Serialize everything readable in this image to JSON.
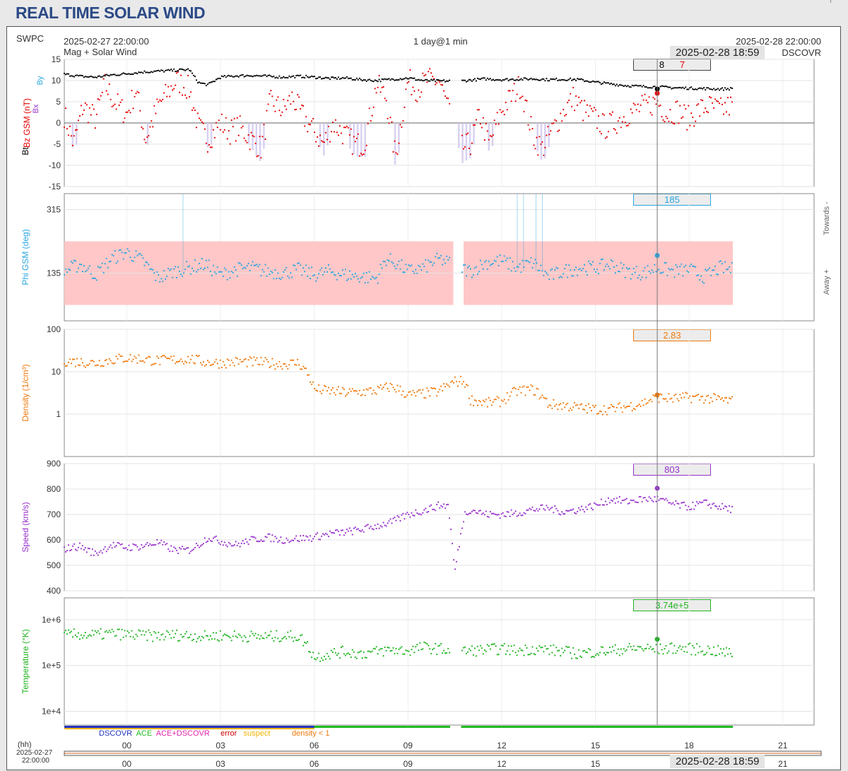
{
  "page": {
    "title": "REAL TIME SOLAR WIND"
  },
  "header": {
    "source": "SWPC",
    "start_time": "2025-02-27 22:00:00",
    "plot_kind": "Mag + Solar Wind",
    "span": "1 day@1 min",
    "end_time": "2025-02-28 22:00:00",
    "cursor_time": "2025-02-28 18:59",
    "spacecraft": "DSCOVR"
  },
  "colors": {
    "bt": "#000000",
    "bz": "#e60000",
    "phi": "#2aa6e0",
    "density": "#f07a0f",
    "speed": "#9933cc",
    "temperature": "#22b522",
    "bz_shade": "#cfc6ec",
    "phi_shade": "#ffc7c7"
  },
  "chart_data": [
    {
      "type": "scatter",
      "name": "mag",
      "ylabel_parts": [
        "Bt",
        "Bz GSM (nT)",
        "Bx",
        "By"
      ],
      "ylim": [
        -15,
        15
      ],
      "yticks": [
        15,
        10,
        5,
        0,
        -5,
        -10,
        -15
      ],
      "readout": {
        "bt": "8",
        "bz": "7"
      },
      "series": [
        {
          "name": "Bt",
          "x": [
            0,
            0.5,
            1,
            1.5,
            2,
            2.5,
            3,
            3.5,
            4,
            4.3,
            4.6,
            5,
            5.5,
            6,
            6.5,
            7,
            7.5,
            8,
            8.5,
            9,
            9.5,
            10,
            10.5,
            11,
            11.5,
            12,
            12.7,
            13,
            13.5,
            14,
            14.5,
            15,
            15.5,
            16,
            16.5,
            17,
            17.5,
            18,
            18.5,
            19,
            19.5,
            20,
            20.5,
            21,
            21.4
          ],
          "y": [
            11.5,
            11,
            10.8,
            11.3,
            11.6,
            12,
            12.2,
            12.4,
            12.6,
            9.5,
            9,
            10.8,
            11.1,
            11.2,
            11,
            10.8,
            11,
            10.8,
            10.5,
            10.6,
            10.2,
            10,
            10.3,
            10.6,
            10,
            9.9,
            9.9,
            10.1,
            10.4,
            10.2,
            10.3,
            10.4,
            10.2,
            10.3,
            10.2,
            9.6,
            9.2,
            8.8,
            8.6,
            8.5,
            8.3,
            8.2,
            8.1,
            8,
            8.1
          ]
        },
        {
          "name": "Bz",
          "x": [
            0,
            0.3,
            0.6,
            1,
            1.3,
            1.6,
            2,
            2.3,
            2.6,
            3,
            3.3,
            3.6,
            4,
            4.3,
            4.6,
            5,
            5.3,
            5.6,
            6,
            6.3,
            6.6,
            7,
            7.3,
            7.6,
            8,
            8.3,
            8.6,
            9,
            9.3,
            9.6,
            10,
            10.3,
            10.6,
            11,
            11.3,
            11.6,
            12,
            12.7,
            13,
            13.3,
            13.6,
            14,
            14.3,
            14.6,
            15,
            15.3,
            15.6,
            16,
            16.3,
            16.6,
            17,
            17.3,
            17.6,
            18,
            18.3,
            18.6,
            19,
            19.3,
            19.6,
            20,
            20.3,
            20.6,
            21,
            21.3
          ],
          "y": [
            2,
            -5,
            4,
            1,
            9,
            5,
            2,
            8,
            -4,
            4,
            7,
            10,
            8,
            -1,
            -4,
            0,
            -2,
            -1,
            -4,
            -6,
            5,
            3,
            6,
            2,
            -2,
            -5,
            0,
            -3,
            -5,
            -5,
            9,
            6,
            -8,
            10,
            8,
            10,
            10,
            -6,
            -5,
            2,
            -5,
            3,
            6,
            9,
            -3,
            -6,
            -2,
            3,
            6,
            3,
            1,
            -1,
            0,
            2,
            3,
            4,
            5,
            2,
            3,
            1,
            3,
            4,
            3,
            4
          ]
        }
      ],
      "cursor": {
        "x": 18.98,
        "bt": 8,
        "bz": 7
      }
    },
    {
      "type": "scatter",
      "name": "phi",
      "ylabel": "Phi GSM (deg)",
      "ylim": [
        0,
        360
      ],
      "yticks": [
        315,
        135
      ],
      "right_labels": [
        "Towards -",
        "Away +"
      ],
      "readout": "185",
      "series": [
        {
          "name": "Phi",
          "x": [
            0,
            0.5,
            1,
            1.5,
            2,
            2.5,
            3,
            3.5,
            4,
            4.5,
            5,
            5.5,
            6,
            6.5,
            7,
            7.5,
            8,
            8.5,
            9,
            9.5,
            10,
            10.3,
            10.6,
            11,
            11.5,
            12,
            12.7,
            13,
            13.5,
            14,
            14.5,
            15,
            15.5,
            16,
            16.5,
            17,
            17.5,
            18,
            18.5,
            19,
            19.5,
            20,
            20.5,
            21,
            21.4
          ],
          "y": [
            140,
            160,
            130,
            175,
            195,
            170,
            120,
            140,
            150,
            160,
            130,
            145,
            150,
            140,
            135,
            145,
            130,
            140,
            130,
            125,
            120,
            175,
            165,
            140,
            150,
            175,
            150,
            140,
            165,
            170,
            150,
            165,
            125,
            140,
            150,
            150,
            160,
            140,
            135,
            150,
            140,
            145,
            125,
            150,
            145
          ]
        }
      ],
      "cursor": {
        "x": 18.98,
        "y": 185
      }
    },
    {
      "type": "scatter",
      "name": "density",
      "ylabel": "Density (1/cm³)",
      "yscale": "log",
      "ylim": [
        0.1,
        100
      ],
      "yticks": [
        100,
        10,
        1
      ],
      "readout": "2.83",
      "series": [
        {
          "name": "Density",
          "x": [
            0,
            0.5,
            1,
            1.5,
            2,
            2.5,
            3,
            3.5,
            4,
            4.5,
            5,
            5.5,
            6,
            6.5,
            7,
            7.5,
            8,
            8.5,
            9,
            9.5,
            10,
            10.5,
            11,
            11.5,
            12,
            12.5,
            12.8,
            13,
            13.5,
            14,
            14.5,
            15,
            15.5,
            16,
            16.5,
            17,
            17.5,
            18,
            18.5,
            19,
            19.5,
            20,
            20.5,
            21,
            21.4
          ],
          "y": [
            18,
            17,
            16,
            19,
            21,
            20,
            18,
            19,
            20,
            17,
            16,
            17,
            17,
            16,
            15,
            16,
            3.8,
            3.5,
            3.2,
            3.3,
            3.6,
            4.5,
            2.8,
            3,
            3.4,
            5.8,
            6,
            2.2,
            1.8,
            2,
            3.5,
            3.8,
            1.7,
            1.6,
            1.4,
            1.3,
            1.3,
            1.5,
            1.8,
            2.5,
            2.3,
            2.5,
            2.4,
            2.2,
            2
          ]
        }
      ],
      "cursor": {
        "x": 18.98,
        "y": 2.83
      }
    },
    {
      "type": "scatter",
      "name": "speed",
      "ylabel": "Speed (km/s)",
      "ylim": [
        400,
        900
      ],
      "yticks": [
        900,
        800,
        700,
        600,
        500,
        400
      ],
      "readout": "803",
      "series": [
        {
          "name": "Speed",
          "x": [
            0,
            0.5,
            1,
            1.5,
            2,
            2.5,
            3,
            3.5,
            4,
            4.3,
            4.6,
            5,
            5.5,
            6,
            6.5,
            7,
            7.5,
            8,
            8.5,
            9,
            9.5,
            10,
            10.5,
            11,
            11.5,
            12,
            12.3,
            12.5,
            12.8,
            13,
            13.5,
            14,
            14.5,
            15,
            15.5,
            16,
            16.5,
            17,
            17.5,
            18,
            18.5,
            19,
            19.5,
            20,
            20.5,
            21,
            21.4
          ],
          "y": [
            565,
            575,
            545,
            580,
            570,
            575,
            590,
            560,
            560,
            580,
            610,
            595,
            580,
            600,
            610,
            600,
            605,
            610,
            625,
            630,
            640,
            655,
            670,
            700,
            715,
            735,
            735,
            475,
            700,
            720,
            700,
            700,
            705,
            720,
            725,
            710,
            720,
            735,
            760,
            750,
            760,
            760,
            740,
            730,
            745,
            730,
            720
          ]
        }
      ],
      "cursor": {
        "x": 18.98,
        "y": 803
      }
    },
    {
      "type": "scatter",
      "name": "temperature",
      "ylabel": "Temperature (°K)",
      "yscale": "log",
      "ylim": [
        5000,
        3000000
      ],
      "yticks": [
        "1e+6",
        "1e+5",
        "1e+4"
      ],
      "readout": "3.74e+5",
      "series": [
        {
          "name": "Temperature",
          "x": [
            0,
            0.5,
            1,
            1.5,
            2,
            2.5,
            3,
            3.5,
            4,
            4.5,
            5,
            5.5,
            6,
            6.5,
            7,
            7.5,
            8,
            8.5,
            9,
            9.5,
            10,
            10.5,
            11,
            11.5,
            12,
            12.7,
            13,
            13.5,
            14,
            14.5,
            15,
            15.5,
            16,
            16.5,
            17,
            17.5,
            18,
            18.5,
            19,
            19.5,
            20,
            20.5,
            21,
            21.4
          ],
          "y": [
            450000,
            480000,
            460000,
            500000,
            470000,
            450000,
            440000,
            460000,
            450000,
            430000,
            450000,
            440000,
            430000,
            420000,
            440000,
            430000,
            150000,
            180000,
            200000,
            180000,
            200000,
            220000,
            210000,
            250000,
            230000,
            200000,
            210000,
            220000,
            230000,
            210000,
            230000,
            220000,
            200000,
            180000,
            200000,
            210000,
            230000,
            240000,
            220000,
            240000,
            230000,
            220000,
            200000,
            180000
          ]
        }
      ],
      "cursor": {
        "x": 18.98,
        "y": 374000
      }
    }
  ],
  "timeline": {
    "hours_label": "(hh)",
    "start_date": "2025-02-27",
    "start_clock": "22:00:00",
    "ticks": [
      "00",
      "03",
      "06",
      "09",
      "12",
      "15",
      "18",
      "21"
    ],
    "flags": [
      "DSCOVR",
      "ACE",
      "ACE+DSCOVR",
      "error",
      "suspect",
      "density < 1"
    ],
    "flag_colors": [
      "#2233bb",
      "#22bb22",
      "#dd22aa",
      "#cc0000",
      "#f0b400",
      "#f07a0f"
    ]
  }
}
